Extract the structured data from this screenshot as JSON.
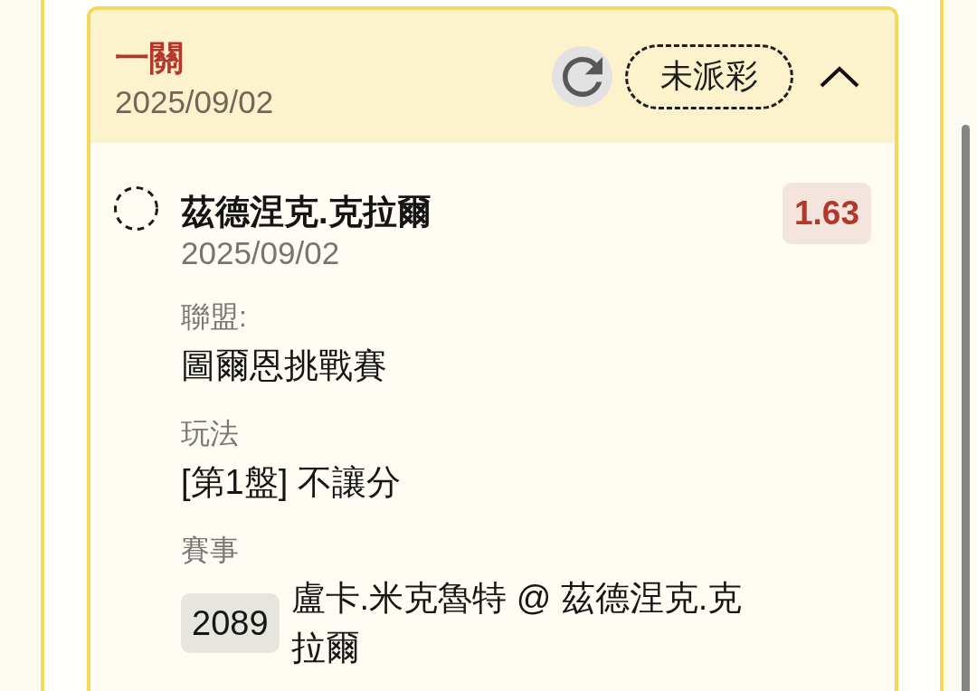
{
  "bet": {
    "title": "一關",
    "date": "2025/09/02",
    "status": "未派彩",
    "expanded": true,
    "selection": {
      "settled": false,
      "name": "茲德涅克.克拉爾",
      "date": "2025/09/02",
      "odds": "1.63",
      "fields": [
        {
          "kind": "text",
          "label": "聯盟:",
          "value": "圖爾恩挑戰賽"
        },
        {
          "kind": "text",
          "label": "玩法",
          "value": "[第1盤] 不讓分"
        },
        {
          "kind": "match",
          "label": "賽事",
          "code": "2089",
          "value": "盧卡.米克魯特 @ 茲德涅克.克拉爾"
        }
      ]
    }
  }
}
